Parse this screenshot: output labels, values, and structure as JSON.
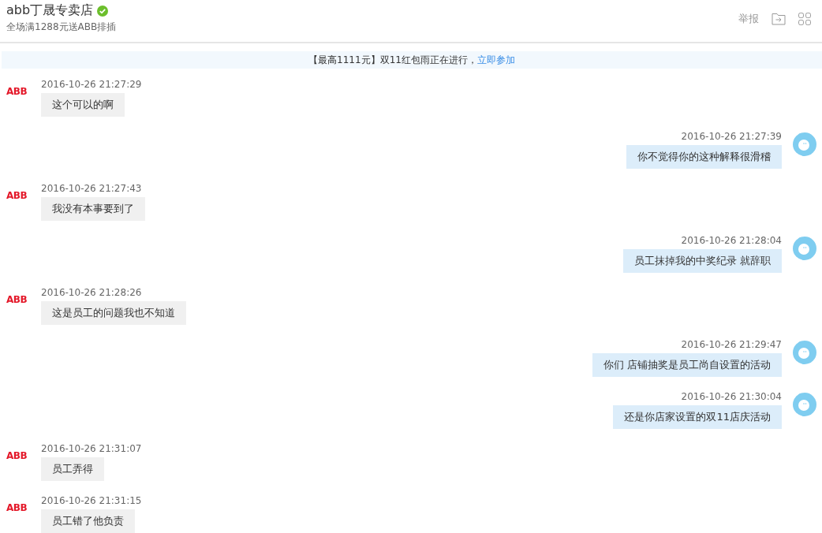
{
  "header": {
    "shop_name": "abb丁晟专卖店",
    "verified": true,
    "subtitle": "全场满1288元送ABB排插",
    "report": "举报"
  },
  "banner": {
    "text": "【最高1111元】双11红包雨正在进行，",
    "link": "立即参加"
  },
  "messages": [
    {
      "kind": "incoming",
      "avatar_label": "ABB",
      "time": "2016-10-26 21:27:29",
      "text": "这个可以的啊"
    },
    {
      "kind": "outgoing",
      "time": "2016-10-26 21:27:39",
      "text": "你不觉得你的这种解释很滑稽"
    },
    {
      "kind": "incoming",
      "avatar_label": "ABB",
      "time": "2016-10-26 21:27:43",
      "text": "我没有本事要到了"
    },
    {
      "kind": "outgoing",
      "time": "2016-10-26 21:28:04",
      "text": "员工抹掉我的中奖纪录 就辞职"
    },
    {
      "kind": "incoming",
      "avatar_label": "ABB",
      "time": "2016-10-26 21:28:26",
      "text": "这是员工的问题我也不知道"
    },
    {
      "kind": "outgoing",
      "time": "2016-10-26 21:29:47",
      "text": "你们 店铺抽奖是员工尚自设置的活动"
    },
    {
      "kind": "outgoing",
      "time": "2016-10-26 21:30:04",
      "text": "还是你店家设置的双11店庆活动"
    },
    {
      "kind": "incoming",
      "avatar_label": "ABB",
      "time": "2016-10-26 21:31:07",
      "text": "员工弄得"
    },
    {
      "kind": "incoming",
      "avatar_label": "ABB",
      "time": "2016-10-26 21:31:15",
      "text": "员工错了他负责"
    }
  ]
}
